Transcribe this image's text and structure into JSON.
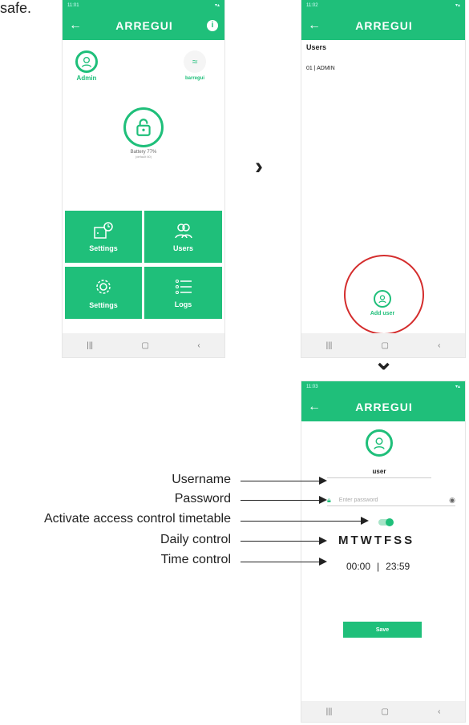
{
  "top_fragment": "safe.",
  "screen_a": {
    "time": "11:01",
    "brand": "ARREGUI",
    "info_icon": "info-icon",
    "admin_label": "Admin",
    "device_name": "barregui",
    "battery": "Battery 77%",
    "battery_sub": "(default 60)",
    "tiles": [
      {
        "label": "Settings",
        "icon": "door-timer-icon"
      },
      {
        "label": "Users",
        "icon": "users-icon"
      },
      {
        "label": "Settings",
        "icon": "gear-icon"
      },
      {
        "label": "Logs",
        "icon": "list-icon"
      }
    ]
  },
  "screen_b": {
    "time": "11:02",
    "brand": "ARREGUI",
    "section_title": "Users",
    "user_entry": "01 | ADMIN",
    "add_user_label": "Add user"
  },
  "screen_c": {
    "time": "11:03",
    "brand": "ARREGUI",
    "username_value": "user",
    "password_placeholder": "Enter password",
    "days": "MTWTFSS",
    "time_from": "00:00",
    "time_sep": "|",
    "time_to": "23:59",
    "save_label": "Save"
  },
  "annotations": {
    "username": "Username",
    "password": "Password",
    "timetable": "Activate access control timetable",
    "daily": "Daily control",
    "time": "Time control"
  },
  "flow_arrows": {
    "right": "›",
    "down": "⌄"
  }
}
